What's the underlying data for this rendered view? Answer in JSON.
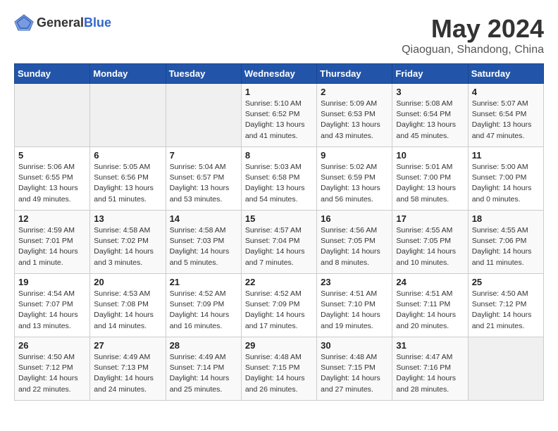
{
  "header": {
    "logo_general": "General",
    "logo_blue": "Blue",
    "title": "May 2024",
    "subtitle": "Qiaoguan, Shandong, China"
  },
  "days_of_week": [
    "Sunday",
    "Monday",
    "Tuesday",
    "Wednesday",
    "Thursday",
    "Friday",
    "Saturday"
  ],
  "weeks": [
    [
      {
        "day": "",
        "empty": true
      },
      {
        "day": "",
        "empty": true
      },
      {
        "day": "",
        "empty": true
      },
      {
        "day": "1",
        "sunrise": "5:10 AM",
        "sunset": "6:52 PM",
        "daylight": "13 hours and 41 minutes."
      },
      {
        "day": "2",
        "sunrise": "5:09 AM",
        "sunset": "6:53 PM",
        "daylight": "13 hours and 43 minutes."
      },
      {
        "day": "3",
        "sunrise": "5:08 AM",
        "sunset": "6:54 PM",
        "daylight": "13 hours and 45 minutes."
      },
      {
        "day": "4",
        "sunrise": "5:07 AM",
        "sunset": "6:54 PM",
        "daylight": "13 hours and 47 minutes."
      }
    ],
    [
      {
        "day": "5",
        "sunrise": "5:06 AM",
        "sunset": "6:55 PM",
        "daylight": "13 hours and 49 minutes."
      },
      {
        "day": "6",
        "sunrise": "5:05 AM",
        "sunset": "6:56 PM",
        "daylight": "13 hours and 51 minutes."
      },
      {
        "day": "7",
        "sunrise": "5:04 AM",
        "sunset": "6:57 PM",
        "daylight": "13 hours and 53 minutes."
      },
      {
        "day": "8",
        "sunrise": "5:03 AM",
        "sunset": "6:58 PM",
        "daylight": "13 hours and 54 minutes."
      },
      {
        "day": "9",
        "sunrise": "5:02 AM",
        "sunset": "6:59 PM",
        "daylight": "13 hours and 56 minutes."
      },
      {
        "day": "10",
        "sunrise": "5:01 AM",
        "sunset": "7:00 PM",
        "daylight": "13 hours and 58 minutes."
      },
      {
        "day": "11",
        "sunrise": "5:00 AM",
        "sunset": "7:00 PM",
        "daylight": "14 hours and 0 minutes."
      }
    ],
    [
      {
        "day": "12",
        "sunrise": "4:59 AM",
        "sunset": "7:01 PM",
        "daylight": "14 hours and 1 minute."
      },
      {
        "day": "13",
        "sunrise": "4:58 AM",
        "sunset": "7:02 PM",
        "daylight": "14 hours and 3 minutes."
      },
      {
        "day": "14",
        "sunrise": "4:58 AM",
        "sunset": "7:03 PM",
        "daylight": "14 hours and 5 minutes."
      },
      {
        "day": "15",
        "sunrise": "4:57 AM",
        "sunset": "7:04 PM",
        "daylight": "14 hours and 7 minutes."
      },
      {
        "day": "16",
        "sunrise": "4:56 AM",
        "sunset": "7:05 PM",
        "daylight": "14 hours and 8 minutes."
      },
      {
        "day": "17",
        "sunrise": "4:55 AM",
        "sunset": "7:05 PM",
        "daylight": "14 hours and 10 minutes."
      },
      {
        "day": "18",
        "sunrise": "4:55 AM",
        "sunset": "7:06 PM",
        "daylight": "14 hours and 11 minutes."
      }
    ],
    [
      {
        "day": "19",
        "sunrise": "4:54 AM",
        "sunset": "7:07 PM",
        "daylight": "14 hours and 13 minutes."
      },
      {
        "day": "20",
        "sunrise": "4:53 AM",
        "sunset": "7:08 PM",
        "daylight": "14 hours and 14 minutes."
      },
      {
        "day": "21",
        "sunrise": "4:52 AM",
        "sunset": "7:09 PM",
        "daylight": "14 hours and 16 minutes."
      },
      {
        "day": "22",
        "sunrise": "4:52 AM",
        "sunset": "7:09 PM",
        "daylight": "14 hours and 17 minutes."
      },
      {
        "day": "23",
        "sunrise": "4:51 AM",
        "sunset": "7:10 PM",
        "daylight": "14 hours and 19 minutes."
      },
      {
        "day": "24",
        "sunrise": "4:51 AM",
        "sunset": "7:11 PM",
        "daylight": "14 hours and 20 minutes."
      },
      {
        "day": "25",
        "sunrise": "4:50 AM",
        "sunset": "7:12 PM",
        "daylight": "14 hours and 21 minutes."
      }
    ],
    [
      {
        "day": "26",
        "sunrise": "4:50 AM",
        "sunset": "7:12 PM",
        "daylight": "14 hours and 22 minutes."
      },
      {
        "day": "27",
        "sunrise": "4:49 AM",
        "sunset": "7:13 PM",
        "daylight": "14 hours and 24 minutes."
      },
      {
        "day": "28",
        "sunrise": "4:49 AM",
        "sunset": "7:14 PM",
        "daylight": "14 hours and 25 minutes."
      },
      {
        "day": "29",
        "sunrise": "4:48 AM",
        "sunset": "7:15 PM",
        "daylight": "14 hours and 26 minutes."
      },
      {
        "day": "30",
        "sunrise": "4:48 AM",
        "sunset": "7:15 PM",
        "daylight": "14 hours and 27 minutes."
      },
      {
        "day": "31",
        "sunrise": "4:47 AM",
        "sunset": "7:16 PM",
        "daylight": "14 hours and 28 minutes."
      },
      {
        "day": "",
        "empty": true
      }
    ]
  ],
  "labels": {
    "sunrise_prefix": "Sunrise: ",
    "sunset_prefix": "Sunset: ",
    "daylight_prefix": "Daylight: "
  }
}
